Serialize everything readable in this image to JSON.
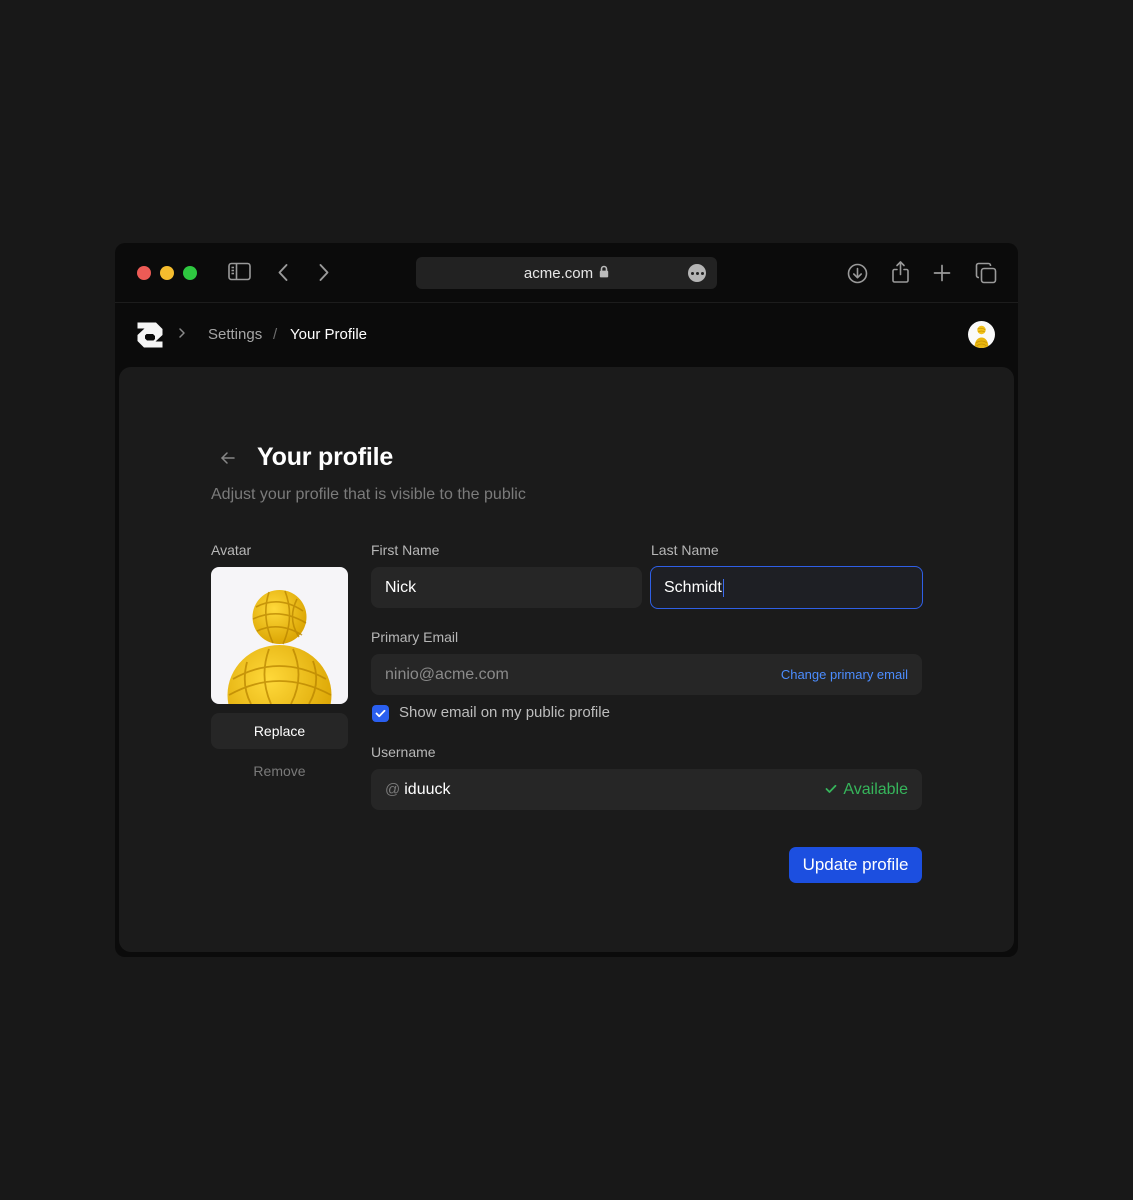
{
  "browser": {
    "url": "acme.com",
    "icons": [
      "sidebar-icon",
      "back-icon",
      "forward-icon",
      "lock-icon",
      "more-icon",
      "download-icon",
      "share-icon",
      "new-tab-icon",
      "tabs-icon"
    ]
  },
  "header": {
    "breadcrumb": {
      "settings": "Settings",
      "separator": "/",
      "current": "Your Profile"
    }
  },
  "page": {
    "title": "Your profile",
    "subtitle": "Adjust your profile that is visible to the public"
  },
  "avatar": {
    "label": "Avatar",
    "replace_label": "Replace",
    "remove_label": "Remove"
  },
  "form": {
    "first_name": {
      "label": "First Name",
      "value": "Nick"
    },
    "last_name": {
      "label": "Last Name",
      "value": "Schmidt"
    },
    "email": {
      "label": "Primary Email",
      "value": "ninio@acme.com",
      "change_link": "Change primary email",
      "show_public_label": "Show email on my public profile",
      "show_public_checked": true
    },
    "username": {
      "label": "Username",
      "prefix": "@",
      "value": "iduuck",
      "status": "Available"
    },
    "submit_label": "Update profile"
  },
  "colors": {
    "accent": "#1c4fe0",
    "link": "#4c8dff",
    "success": "#36b55b",
    "avatar_yarn": "#f2c21b"
  }
}
